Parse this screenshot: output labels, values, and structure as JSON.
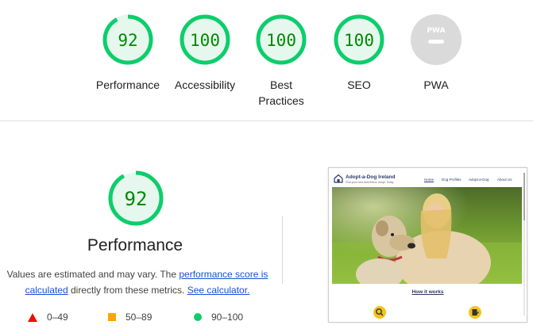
{
  "summary_gauges": [
    {
      "label": "Performance",
      "score": "92",
      "value": 92,
      "color": "#0cce6b"
    },
    {
      "label": "Accessibility",
      "score": "100",
      "value": 100,
      "color": "#0cce6b"
    },
    {
      "label": "Best Practices",
      "label_line1": "Best",
      "label_line2": "Practices",
      "score": "100",
      "value": 100,
      "color": "#0cce6b"
    },
    {
      "label": "SEO",
      "score": "100",
      "value": 100,
      "color": "#0cce6b"
    },
    {
      "label": "PWA",
      "badge": "PWA",
      "color": "#cccccc"
    }
  ],
  "performance": {
    "score": "92",
    "value": 92,
    "title": "Performance",
    "desc_prefix": "Values are estimated and may vary. The ",
    "link1": "performance score is calculated",
    "desc_middle": " directly from these metrics. ",
    "link2": "See calculator."
  },
  "legend": [
    {
      "range": "0–49",
      "shape": "triangle",
      "color": "#eb0f00"
    },
    {
      "range": "50–89",
      "shape": "square",
      "color": "#ffa400"
    },
    {
      "range": "90–100",
      "shape": "circle",
      "color": "#0cce6b"
    }
  ],
  "thumbnail": {
    "brand": "Adopt-a-Dog Ireland",
    "tagline": "Find your new best friend. Adopt Today",
    "nav": [
      "Home",
      "Dog Profiles",
      "Adopt-a-Dog",
      "About Us"
    ],
    "section_link": "How it works"
  },
  "colors": {
    "pass": "#0cce6b",
    "pass_text": "#008800",
    "average": "#ffa400",
    "fail": "#eb0f00",
    "pwa": "#cccccc"
  }
}
